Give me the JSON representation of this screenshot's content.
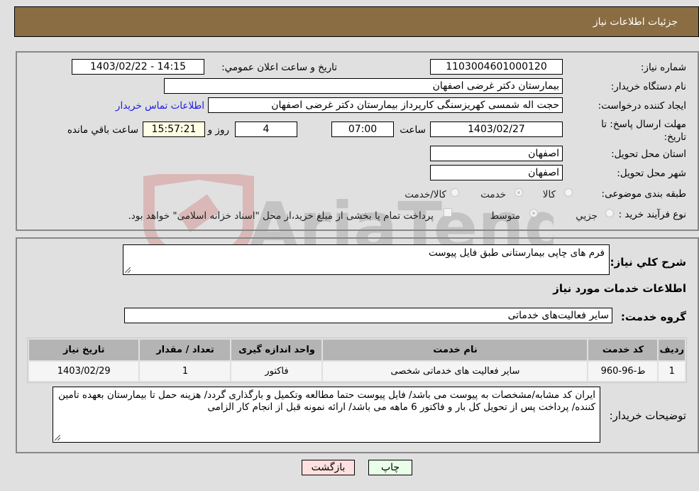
{
  "header": {
    "title": "جزئیات اطلاعات نیاز"
  },
  "fields": {
    "need_number_label": "شماره نیاز:",
    "need_number": "1103004601000120",
    "announce_label": "تاریخ و ساعت اعلان عمومي:",
    "announce_value": "1403/02/22 - 14:15",
    "buyer_org_label": "نام دستگاه خريدار:",
    "buyer_org": "بیمارستان دکتر غرضی اصفهان",
    "creator_label": "ايجاد کننده درخواست:",
    "creator": "حجت اله شمسی کهریزسنگی کارپرداز بیمارستان دکتر غرضی اصفهان",
    "contact_link": "اطلاعات تماس خريدار",
    "deadline_label": "مهلت ارسال پاسخ: تا تاریخ:",
    "deadline_date": "1403/02/27",
    "time_label": "ساعت",
    "deadline_time": "07:00",
    "days_value": "4",
    "days_label": "روز و",
    "remaining_time": "15:57:21",
    "remaining_label": "ساعت باقي مانده",
    "province_label": "استان محل تحویل:",
    "province": "اصفهان",
    "city_label": "شهر محل تحویل:",
    "city": "اصفهان",
    "category_label": "طبقه بندی موضوعی:",
    "category_options": [
      {
        "label": "کالا",
        "selected": false
      },
      {
        "label": "خدمت",
        "selected": true
      },
      {
        "label": "کالا/خدمت",
        "selected": false
      }
    ],
    "process_label": "نوع فرآیند خرید :",
    "process_options": [
      {
        "label": "جزيي",
        "selected": false
      },
      {
        "label": "متوسط",
        "selected": true
      }
    ],
    "treasury_note": "پرداخت تمام يا بخشی از مبلغ خرید،از محل \"اسناد خزانه اسلامی\" خواهد بود.",
    "treasury_checked": false
  },
  "details": {
    "summary_label": "شرح کلي نياز:",
    "summary": "فرم های چاپی بیمارستانی طبق فایل پیوست",
    "services_heading": "اطلاعات خدمات مورد نیاز",
    "service_group_label": "گروه خدمت:",
    "service_group": "سایر فعالیت‌های خدماتی"
  },
  "table": {
    "headers": [
      "ردیف",
      "کد خدمت",
      "نام خدمت",
      "واحد اندازه گیری",
      "تعداد / مقدار",
      "تاریخ نیاز"
    ],
    "rows": [
      [
        "1",
        "ط-96-960",
        "سایر فعالیت های خدماتی شخصی",
        "فاکتور",
        "1",
        "1403/02/29"
      ]
    ]
  },
  "buyer_notes": {
    "label": "توضیحات خريدار:",
    "text": "ایران کد مشابه/مشخصات به پیوست می باشد/ فایل پیوست حتما مطالعه وتکمیل و بارگذاری گردد/ هزینه حمل تا بیمارستان بعهده تامین کننده/ پرداخت پس از تحویل کل بار و فاکتور 6 ماهه می باشد/ ارائه نمونه قبل از انجام کار الزامی"
  },
  "buttons": {
    "print": "چاپ",
    "back": "بازگشت"
  },
  "watermark": {
    "text": "AriaTender.neT"
  },
  "colors": {
    "header_bg": "#8b6d43",
    "print_bg": "#eaffea",
    "back_bg": "#ffe0e0",
    "link": "#1a1ae6"
  }
}
